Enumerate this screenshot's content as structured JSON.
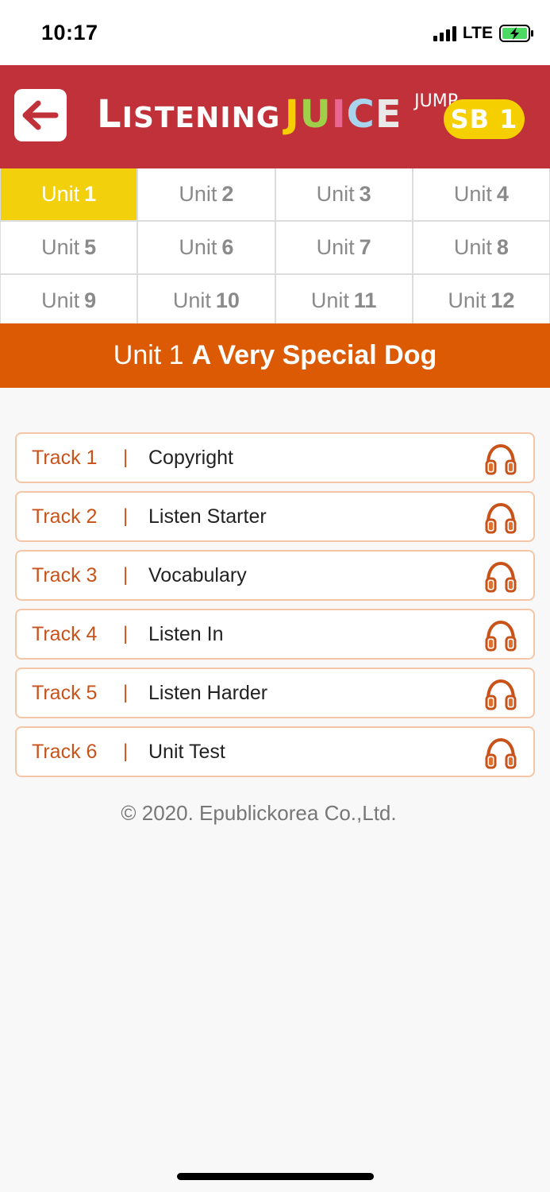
{
  "status_bar": {
    "time": "10:17",
    "network": "LTE"
  },
  "header": {
    "logo_listening_initial": "L",
    "logo_listening_rest": "ISTENING",
    "logo_juice": [
      "J",
      "U",
      "I",
      "C",
      "E"
    ],
    "logo_juice_colors": [
      "#f5cf00",
      "#9fd04a",
      "#e9678f",
      "#a9d4ee",
      "#e9e9e9"
    ],
    "logo_jump": "JUMP",
    "badge": "SB 1",
    "accent_color": "#c0313a"
  },
  "units": [
    {
      "prefix": "Unit",
      "num": "1",
      "active": true
    },
    {
      "prefix": "Unit",
      "num": "2",
      "active": false
    },
    {
      "prefix": "Unit",
      "num": "3",
      "active": false
    },
    {
      "prefix": "Unit",
      "num": "4",
      "active": false
    },
    {
      "prefix": "Unit",
      "num": "5",
      "active": false
    },
    {
      "prefix": "Unit",
      "num": "6",
      "active": false
    },
    {
      "prefix": "Unit",
      "num": "7",
      "active": false
    },
    {
      "prefix": "Unit",
      "num": "8",
      "active": false
    },
    {
      "prefix": "Unit",
      "num": "9",
      "active": false
    },
    {
      "prefix": "Unit",
      "num": "10",
      "active": false
    },
    {
      "prefix": "Unit",
      "num": "11",
      "active": false
    },
    {
      "prefix": "Unit",
      "num": "12",
      "active": false
    }
  ],
  "title_bar": {
    "unit_label": "Unit 1",
    "unit_title": "A Very Special Dog"
  },
  "tracks": [
    {
      "number": "Track 1",
      "separator": "|",
      "name": "Copyright",
      "icon": "headphones-icon"
    },
    {
      "number": "Track 2",
      "separator": "|",
      "name": "Listen Starter",
      "icon": "headphones-icon"
    },
    {
      "number": "Track 3",
      "separator": "|",
      "name": "Vocabulary",
      "icon": "headphones-icon"
    },
    {
      "number": "Track 4",
      "separator": "|",
      "name": "Listen In",
      "icon": "headphones-icon"
    },
    {
      "number": "Track 5",
      "separator": "|",
      "name": "Listen Harder",
      "icon": "headphones-icon"
    },
    {
      "number": "Track 6",
      "separator": "|",
      "name": "Unit Test",
      "icon": "headphones-icon"
    }
  ],
  "footer": {
    "copyright": "© 2020. Epublickorea Co.,Ltd."
  }
}
